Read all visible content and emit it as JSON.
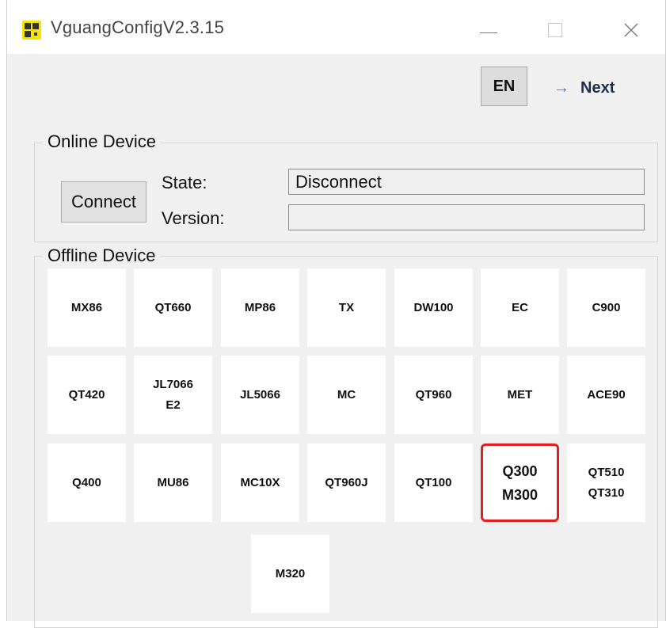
{
  "window": {
    "title": "VguangConfigV2.3.15"
  },
  "toolbar": {
    "language_button": "EN",
    "next_arrow": "→",
    "next_label": "Next"
  },
  "online_device": {
    "legend": "Online Device",
    "connect_button": "Connect",
    "state_label": "State:",
    "state_value": "Disconnect",
    "version_label": "Version:",
    "version_value": ""
  },
  "offline_device": {
    "legend": "Offline Device",
    "devices": [
      {
        "line1": "MX86",
        "line2": ""
      },
      {
        "line1": "QT660",
        "line2": ""
      },
      {
        "line1": "MP86",
        "line2": ""
      },
      {
        "line1": "TX",
        "line2": ""
      },
      {
        "line1": "DW100",
        "line2": ""
      },
      {
        "line1": "EC",
        "line2": ""
      },
      {
        "line1": "C900",
        "line2": ""
      },
      {
        "line1": "QT420",
        "line2": ""
      },
      {
        "line1": "JL7066",
        "line2": "E2"
      },
      {
        "line1": "JL5066",
        "line2": ""
      },
      {
        "line1": "MC",
        "line2": ""
      },
      {
        "line1": "QT960",
        "line2": ""
      },
      {
        "line1": "MET",
        "line2": ""
      },
      {
        "line1": "ACE90",
        "line2": ""
      },
      {
        "line1": "Q400",
        "line2": ""
      },
      {
        "line1": "MU86",
        "line2": ""
      },
      {
        "line1": "MC10X",
        "line2": ""
      },
      {
        "line1": "QT960J",
        "line2": ""
      },
      {
        "line1": "QT100",
        "line2": ""
      },
      {
        "line1": "Q300",
        "line2": "M300"
      },
      {
        "line1": "QT510",
        "line2": "QT310"
      },
      {
        "line1": "M320",
        "line2": ""
      }
    ]
  },
  "highlight_color": "#e02020"
}
